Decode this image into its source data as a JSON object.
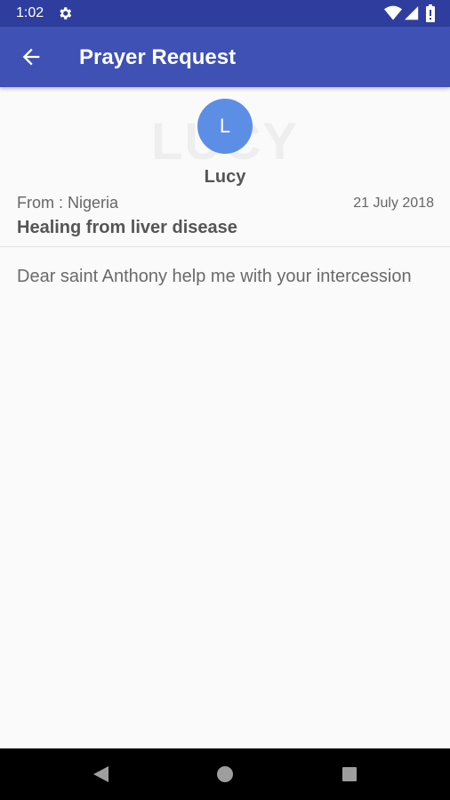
{
  "status_bar": {
    "time": "1:02",
    "icons": [
      "gear-icon",
      "wifi-icon",
      "signal-icon",
      "battery-icon"
    ]
  },
  "app_bar": {
    "title": "Prayer Request",
    "back_icon": "arrow-back-icon",
    "color": "#3f51b5"
  },
  "request": {
    "watermark": "LUCY",
    "avatar_letter": "L",
    "avatar_color": "#5c8ee6",
    "author": "Lucy",
    "from": "From : Nigeria",
    "date": "21 July 2018",
    "title": "Healing from liver disease",
    "message": "Dear saint Anthony help me with your intercession"
  },
  "nav_bar": {
    "icons": [
      "back-triangle-icon",
      "home-circle-icon",
      "recents-square-icon"
    ]
  }
}
